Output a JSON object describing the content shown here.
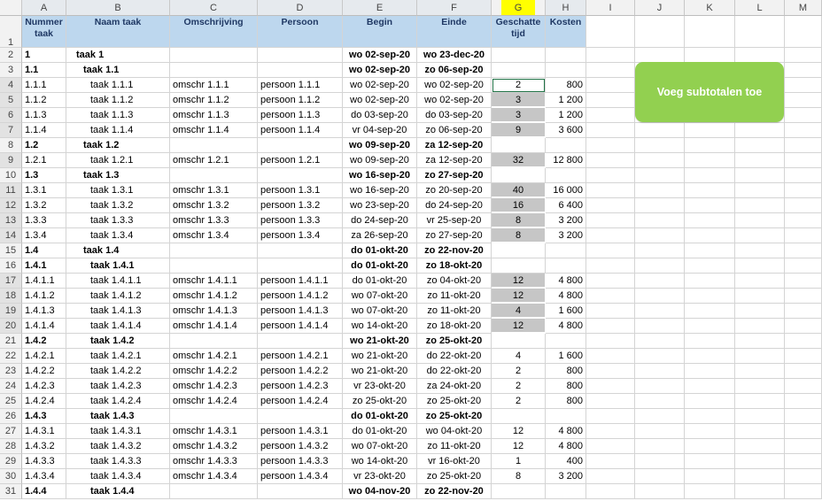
{
  "columns": [
    "A",
    "B",
    "C",
    "D",
    "E",
    "F",
    "G",
    "H",
    "I",
    "J",
    "K",
    "L",
    "M"
  ],
  "header": {
    "row_number": "1",
    "a": "Nummer taak",
    "b": "Naam taak",
    "c": "Omschrijving",
    "d": "Persoon",
    "e": "Begin",
    "f": "Einde",
    "g": "Geschatte tijd",
    "h": "Kosten"
  },
  "rows": [
    {
      "n": "2",
      "a": "1",
      "b": "taak 1",
      "c": "",
      "d": "",
      "e": "wo 02-sep-20",
      "f": "wo 23-dec-20",
      "g": "",
      "h": "",
      "lvl": 0,
      "bold": true,
      "gray": false
    },
    {
      "n": "3",
      "a": "1.1",
      "b": "taak 1.1",
      "c": "",
      "d": "",
      "e": "wo 02-sep-20",
      "f": "zo 06-sep-20",
      "g": "",
      "h": "",
      "lvl": 1,
      "bold": true,
      "gray": false
    },
    {
      "n": "4",
      "a": "1.1.1",
      "b": "taak 1.1.1",
      "c": "omschr 1.1.1",
      "d": "persoon 1.1.1",
      "e": "wo 02-sep-20",
      "f": "wo 02-sep-20",
      "g": "2",
      "h": "800",
      "lvl": 2,
      "bold": false,
      "gray": false
    },
    {
      "n": "5",
      "a": "1.1.2",
      "b": "taak 1.1.2",
      "c": "omschr 1.1.2",
      "d": "persoon 1.1.2",
      "e": "wo 02-sep-20",
      "f": "wo 02-sep-20",
      "g": "3",
      "h": "1 200",
      "lvl": 2,
      "bold": false,
      "gray": true
    },
    {
      "n": "6",
      "a": "1.1.3",
      "b": "taak 1.1.3",
      "c": "omschr 1.1.3",
      "d": "persoon 1.1.3",
      "e": "do 03-sep-20",
      "f": "do 03-sep-20",
      "g": "3",
      "h": "1 200",
      "lvl": 2,
      "bold": false,
      "gray": true
    },
    {
      "n": "7",
      "a": "1.1.4",
      "b": "taak 1.1.4",
      "c": "omschr 1.1.4",
      "d": "persoon 1.1.4",
      "e": "vr 04-sep-20",
      "f": "zo 06-sep-20",
      "g": "9",
      "h": "3 600",
      "lvl": 2,
      "bold": false,
      "gray": true
    },
    {
      "n": "8",
      "a": "1.2",
      "b": "taak 1.2",
      "c": "",
      "d": "",
      "e": "wo 09-sep-20",
      "f": "za 12-sep-20",
      "g": "",
      "h": "",
      "lvl": 1,
      "bold": true,
      "gray": false
    },
    {
      "n": "9",
      "a": "1.2.1",
      "b": "taak 1.2.1",
      "c": "omschr 1.2.1",
      "d": "persoon 1.2.1",
      "e": "wo 09-sep-20",
      "f": "za 12-sep-20",
      "g": "32",
      "h": "12 800",
      "lvl": 2,
      "bold": false,
      "gray": true
    },
    {
      "n": "10",
      "a": "1.3",
      "b": "taak 1.3",
      "c": "",
      "d": "",
      "e": "wo 16-sep-20",
      "f": "zo 27-sep-20",
      "g": "",
      "h": "",
      "lvl": 1,
      "bold": true,
      "gray": false
    },
    {
      "n": "11",
      "a": "1.3.1",
      "b": "taak 1.3.1",
      "c": "omschr 1.3.1",
      "d": "persoon 1.3.1",
      "e": "wo 16-sep-20",
      "f": "zo 20-sep-20",
      "g": "40",
      "h": "16 000",
      "lvl": 2,
      "bold": false,
      "gray": true
    },
    {
      "n": "12",
      "a": "1.3.2",
      "b": "taak 1.3.2",
      "c": "omschr 1.3.2",
      "d": "persoon 1.3.2",
      "e": "wo 23-sep-20",
      "f": "do 24-sep-20",
      "g": "16",
      "h": "6 400",
      "lvl": 2,
      "bold": false,
      "gray": true
    },
    {
      "n": "13",
      "a": "1.3.3",
      "b": "taak 1.3.3",
      "c": "omschr 1.3.3",
      "d": "persoon 1.3.3",
      "e": "do 24-sep-20",
      "f": "vr 25-sep-20",
      "g": "8",
      "h": "3 200",
      "lvl": 2,
      "bold": false,
      "gray": true
    },
    {
      "n": "14",
      "a": "1.3.4",
      "b": "taak 1.3.4",
      "c": "omschr 1.3.4",
      "d": "persoon 1.3.4",
      "e": "za 26-sep-20",
      "f": "zo 27-sep-20",
      "g": "8",
      "h": "3 200",
      "lvl": 2,
      "bold": false,
      "gray": true
    },
    {
      "n": "15",
      "a": "1.4",
      "b": "taak 1.4",
      "c": "",
      "d": "",
      "e": "do 01-okt-20",
      "f": "zo 22-nov-20",
      "g": "",
      "h": "",
      "lvl": 1,
      "bold": true,
      "gray": false
    },
    {
      "n": "16",
      "a": "1.4.1",
      "b": "taak 1.4.1",
      "c": "",
      "d": "",
      "e": "do 01-okt-20",
      "f": "zo 18-okt-20",
      "g": "",
      "h": "",
      "lvl": 2,
      "bold": true,
      "gray": false
    },
    {
      "n": "17",
      "a": "1.4.1.1",
      "b": "taak 1.4.1.1",
      "c": "omschr 1.4.1.1",
      "d": "persoon 1.4.1.1",
      "e": "do 01-okt-20",
      "f": "zo 04-okt-20",
      "g": "12",
      "h": "4 800",
      "lvl": 3,
      "bold": false,
      "gray": true
    },
    {
      "n": "18",
      "a": "1.4.1.2",
      "b": "taak 1.4.1.2",
      "c": "omschr 1.4.1.2",
      "d": "persoon 1.4.1.2",
      "e": "wo 07-okt-20",
      "f": "zo 11-okt-20",
      "g": "12",
      "h": "4 800",
      "lvl": 3,
      "bold": false,
      "gray": true
    },
    {
      "n": "19",
      "a": "1.4.1.3",
      "b": "taak 1.4.1.3",
      "c": "omschr 1.4.1.3",
      "d": "persoon 1.4.1.3",
      "e": "wo 07-okt-20",
      "f": "zo 11-okt-20",
      "g": "4",
      "h": "1 600",
      "lvl": 3,
      "bold": false,
      "gray": true
    },
    {
      "n": "20",
      "a": "1.4.1.4",
      "b": "taak 1.4.1.4",
      "c": "omschr 1.4.1.4",
      "d": "persoon 1.4.1.4",
      "e": "wo 14-okt-20",
      "f": "zo 18-okt-20",
      "g": "12",
      "h": "4 800",
      "lvl": 3,
      "bold": false,
      "gray": true
    },
    {
      "n": "21",
      "a": "1.4.2",
      "b": "taak 1.4.2",
      "c": "",
      "d": "",
      "e": "wo 21-okt-20",
      "f": "zo 25-okt-20",
      "g": "",
      "h": "",
      "lvl": 2,
      "bold": true,
      "gray": false
    },
    {
      "n": "22",
      "a": "1.4.2.1",
      "b": "taak 1.4.2.1",
      "c": "omschr 1.4.2.1",
      "d": "persoon 1.4.2.1",
      "e": "wo 21-okt-20",
      "f": "do 22-okt-20",
      "g": "4",
      "h": "1 600",
      "lvl": 3,
      "bold": false,
      "gray": false
    },
    {
      "n": "23",
      "a": "1.4.2.2",
      "b": "taak 1.4.2.2",
      "c": "omschr 1.4.2.2",
      "d": "persoon 1.4.2.2",
      "e": "wo 21-okt-20",
      "f": "do 22-okt-20",
      "g": "2",
      "h": "800",
      "lvl": 3,
      "bold": false,
      "gray": false
    },
    {
      "n": "24",
      "a": "1.4.2.3",
      "b": "taak 1.4.2.3",
      "c": "omschr 1.4.2.3",
      "d": "persoon 1.4.2.3",
      "e": "vr 23-okt-20",
      "f": "za 24-okt-20",
      "g": "2",
      "h": "800",
      "lvl": 3,
      "bold": false,
      "gray": false
    },
    {
      "n": "25",
      "a": "1.4.2.4",
      "b": "taak 1.4.2.4",
      "c": "omschr 1.4.2.4",
      "d": "persoon 1.4.2.4",
      "e": "zo 25-okt-20",
      "f": "zo 25-okt-20",
      "g": "2",
      "h": "800",
      "lvl": 3,
      "bold": false,
      "gray": false
    },
    {
      "n": "26",
      "a": "1.4.3",
      "b": "taak 1.4.3",
      "c": "",
      "d": "",
      "e": "do 01-okt-20",
      "f": "zo 25-okt-20",
      "g": "",
      "h": "",
      "lvl": 2,
      "bold": true,
      "gray": false
    },
    {
      "n": "27",
      "a": "1.4.3.1",
      "b": "taak 1.4.3.1",
      "c": "omschr 1.4.3.1",
      "d": "persoon 1.4.3.1",
      "e": "do 01-okt-20",
      "f": "wo 04-okt-20",
      "g": "12",
      "h": "4 800",
      "lvl": 3,
      "bold": false,
      "gray": false
    },
    {
      "n": "28",
      "a": "1.4.3.2",
      "b": "taak 1.4.3.2",
      "c": "omschr 1.4.3.2",
      "d": "persoon 1.4.3.2",
      "e": "wo 07-okt-20",
      "f": "zo 11-okt-20",
      "g": "12",
      "h": "4 800",
      "lvl": 3,
      "bold": false,
      "gray": false
    },
    {
      "n": "29",
      "a": "1.4.3.3",
      "b": "taak 1.4.3.3",
      "c": "omschr 1.4.3.3",
      "d": "persoon 1.4.3.3",
      "e": "wo 14-okt-20",
      "f": "vr 16-okt-20",
      "g": "1",
      "h": "400",
      "lvl": 3,
      "bold": false,
      "gray": false
    },
    {
      "n": "30",
      "a": "1.4.3.4",
      "b": "taak 1.4.3.4",
      "c": "omschr 1.4.3.4",
      "d": "persoon 1.4.3.4",
      "e": "vr 23-okt-20",
      "f": "zo 25-okt-20",
      "g": "8",
      "h": "3 200",
      "lvl": 3,
      "bold": false,
      "gray": false
    },
    {
      "n": "31",
      "a": "1.4.4",
      "b": "taak 1.4.4",
      "c": "",
      "d": "",
      "e": "wo 04-nov-20",
      "f": "zo 22-nov-20",
      "g": "",
      "h": "",
      "lvl": 2,
      "bold": true,
      "gray": false
    }
  ],
  "button": {
    "label": "Voeg subtotalen toe"
  },
  "colors": {
    "header_fill": "#bdd7ee",
    "gray_fill": "#c6c6c6",
    "button_fill": "#92d050",
    "selected_col_fill": "#ffff00"
  }
}
